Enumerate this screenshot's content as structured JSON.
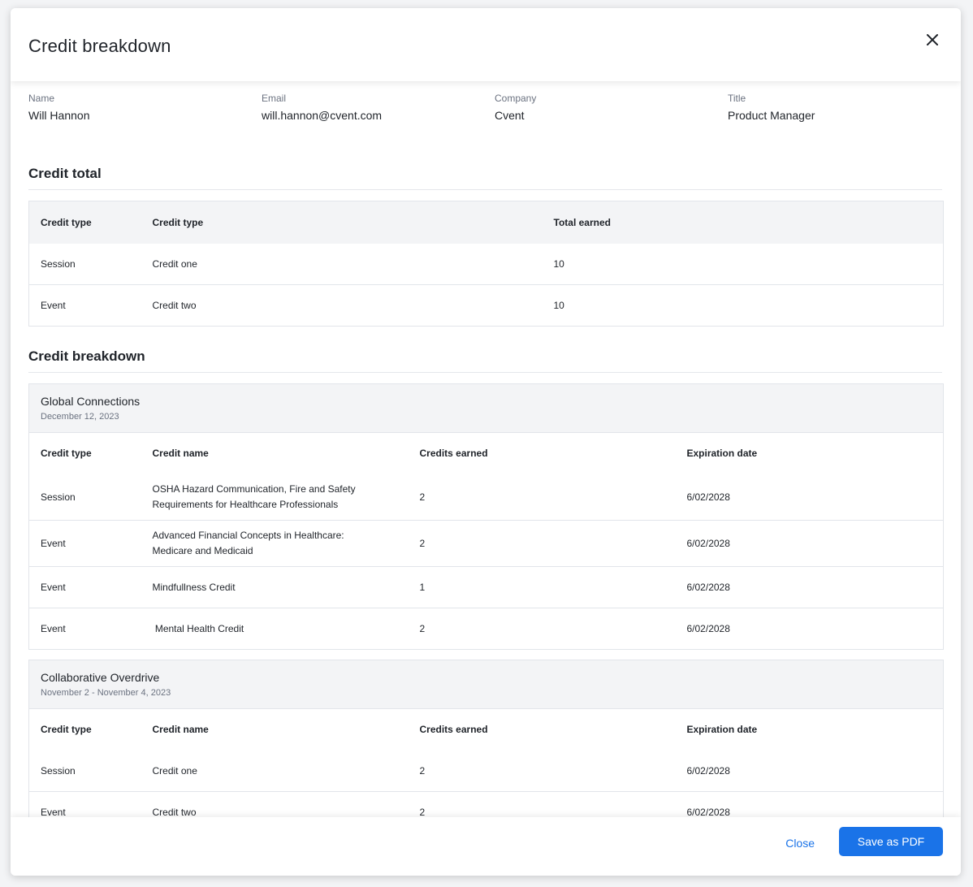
{
  "modal": {
    "title": "Credit breakdown",
    "close_icon": "close-icon"
  },
  "attendee": {
    "fields": [
      {
        "label": "Name",
        "value": "Will Hannon"
      },
      {
        "label": "Email",
        "value": "will.hannon@cvent.com"
      },
      {
        "label": "Company",
        "value": "Cvent"
      },
      {
        "label": "Title",
        "value": "Product Manager"
      }
    ]
  },
  "credit_total": {
    "heading": "Credit total",
    "columns": [
      "Credit type",
      "Credit type",
      "Total earned"
    ],
    "rows": [
      [
        "Session",
        "Credit one",
        "10"
      ],
      [
        "Event",
        "Credit two",
        "10"
      ]
    ]
  },
  "credit_breakdown": {
    "heading": "Credit breakdown",
    "groups": [
      {
        "name": "Global Connections",
        "date": "December 12, 2023",
        "columns": [
          "Credit type",
          "Credit name",
          "Credits earned",
          "Expiration date"
        ],
        "rows": [
          [
            "Session",
            "OSHA Hazard Communication, Fire and Safety Requirements for Healthcare Professionals",
            "2",
            "6/02/2028"
          ],
          [
            "Event",
            "Advanced Financial Concepts in Healthcare: Medicare and Medicaid",
            "2",
            "6/02/2028"
          ],
          [
            "Event",
            "Mindfullness Credit",
            "1",
            "6/02/2028"
          ],
          [
            "Event",
            " Mental Health Credit",
            "2",
            "6/02/2028"
          ]
        ]
      },
      {
        "name": "Collaborative Overdrive",
        "date": "November 2 - November 4, 2023",
        "columns": [
          "Credit type",
          "Credit name",
          "Credits earned",
          "Expiration date"
        ],
        "rows": [
          [
            "Session",
            "Credit one",
            "2",
            "6/02/2028"
          ],
          [
            "Event",
            "Credit two",
            "2",
            "6/02/2028"
          ]
        ]
      }
    ]
  },
  "footer": {
    "close_label": "Close",
    "save_label": "Save as PDF"
  },
  "colors": {
    "accent": "#1a73e8",
    "header_bg": "#f3f4f6"
  }
}
